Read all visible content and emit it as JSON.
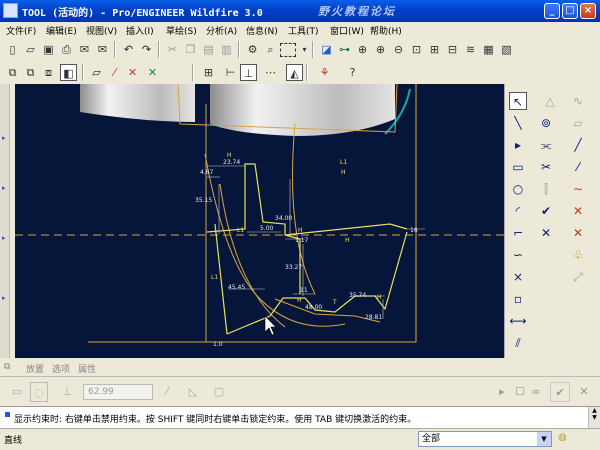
{
  "window": {
    "title": "TOOL (活动的) - Pro/ENGINEER Wildfire 3.0",
    "watermark": "野火教程论坛"
  },
  "menu": [
    "文件(F)",
    "编辑(E)",
    "视图(V)",
    "插入(I)",
    "草绘(S)",
    "分析(A)",
    "信息(N)",
    "工具(T)",
    "窗口(W)",
    "帮助(H)"
  ],
  "sketch": {
    "dimensions": [
      "4.67",
      "23.74",
      "35.15",
      "34.00",
      "5.00",
      "1.17",
      "33.27",
      "16",
      "45.45",
      "11",
      "48.00",
      "35.74",
      "28.81",
      "1.0"
    ],
    "constraint_labels": [
      "H",
      "L1",
      "H",
      "L1",
      "H",
      "H",
      "H",
      "L1",
      "T",
      "H"
    ]
  },
  "dashboard": {
    "tabs": [
      "放置",
      "选项",
      "属性"
    ],
    "dimension_value": "62.99"
  },
  "message": "显示约束时: 右键单击禁用约束。按 SHIFT 键同时右键单击锁定约束。使用 TAB 键切换激活的约束。",
  "status": {
    "text": "直线",
    "filter": "全部"
  }
}
